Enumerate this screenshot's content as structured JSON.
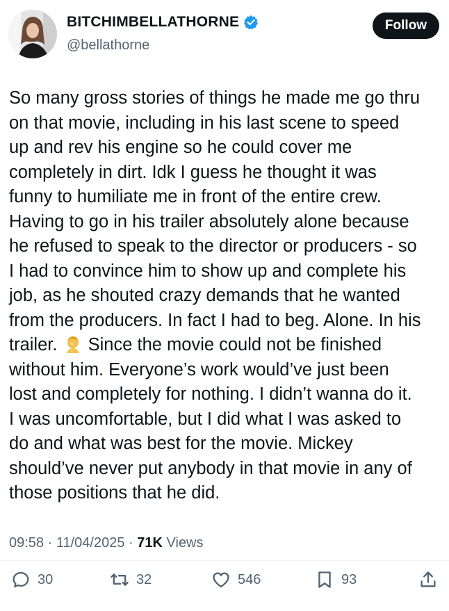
{
  "user": {
    "display_name": "BITCHIMBELLATHORNE",
    "handle": "@bellathorne",
    "verified": true
  },
  "follow_label": "Follow",
  "tweet": {
    "text_part1": "So many gross stories of things he made me go thru\non that movie, including in his last scene to speed\nup and rev his engine so he could cover me\ncompletely in dirt. Idk I guess he thought it was\nfunny to humiliate me in front of the entire crew.\nHaving to go in his trailer absolutely alone because\nhe refused to speak to the director or producers - so\nI had to convince him to show up and complete his\njob, as he shouted crazy demands that he wanted\nfrom the producers. In fact I had to beg. Alone. In his\ntrailer. ",
    "emoji": "person-facepalming",
    "text_part2": " Since the movie could not be finished\nwithout him. Everyone’s work would’ve just been\nlost and completely for nothing. I didn’t wanna do it.\nI was uncomfortable, but I did what I was asked to\ndo and what was best for the movie. Mickey\nshould’ve never put anybody in that movie in any of\nthose positions that he did."
  },
  "meta": {
    "time": "09:58",
    "date": "11/04/2025",
    "views_count": "71K",
    "views_label": "Views"
  },
  "actions": {
    "replies": "30",
    "reposts": "32",
    "likes": "546",
    "bookmarks": "93"
  },
  "colors": {
    "text": "#0f1419",
    "secondary": "#536471",
    "verified": "#1d9bf0",
    "follow_bg": "#0f1419"
  }
}
